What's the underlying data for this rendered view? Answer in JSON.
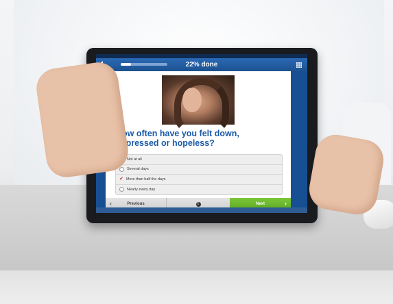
{
  "survey": {
    "progress_label": "22% done",
    "progress_fraction": 0.22,
    "question": "How often have you felt down, depressed or hopeless?",
    "options": [
      {
        "label": "Not at all",
        "selected": false
      },
      {
        "label": "Several days",
        "selected": false
      },
      {
        "label": "More than half the days",
        "selected": true
      },
      {
        "label": "Nearly every day",
        "selected": false
      }
    ],
    "previous_label": "Previous",
    "next_label": "Next",
    "info_icon": "i"
  },
  "colors": {
    "header_blue": "#1c528f",
    "question_blue": "#1a5aa8",
    "next_green": "#5aa820",
    "check_red": "#c0282d"
  },
  "icons": {
    "back": "back-arrow-icon",
    "menu": "grid-menu-icon",
    "info": "info-icon",
    "previous": "chevron-left-icon",
    "next": "chevron-right-icon"
  }
}
